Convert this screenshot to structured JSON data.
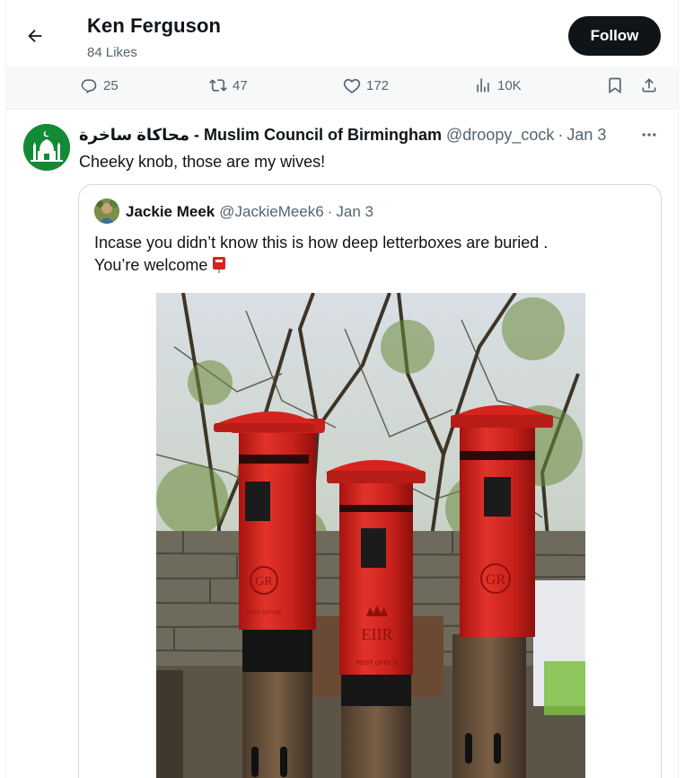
{
  "header": {
    "title": "Ken Ferguson",
    "subtitle": "84 Likes",
    "follow_label": "Follow"
  },
  "actions": {
    "replies": "25",
    "retweets": "47",
    "likes": "172",
    "views": "10K"
  },
  "tweet": {
    "author_name": "محاكاة ساخرة - Muslim Council of Birmingham",
    "handle": "@droopy_cock",
    "separator": "·",
    "date": "Jan 3",
    "text": "Cheeky knob, those are my wives!",
    "avatar_color": "#138a36"
  },
  "quote": {
    "author_name": "Jackie Meek",
    "handle": "@JackieMeek6",
    "separator": "·",
    "date": "Jan 3",
    "text_line1": "Incase you didn’t know this is how deep letterboxes are buried .",
    "text_line2": "You’re welcome",
    "photo_text": {
      "left_box_cipher": "GR",
      "left_box_label": "POST OFFICE",
      "middle_box_cipher": "EIIR",
      "middle_box_label": "POST OFFICE",
      "right_box_cipher": "GR"
    }
  },
  "colors": {
    "follow_bg": "#0f1419",
    "muted_text": "#536471",
    "border": "#cfd9de",
    "postbox_red": "#d7231e"
  }
}
